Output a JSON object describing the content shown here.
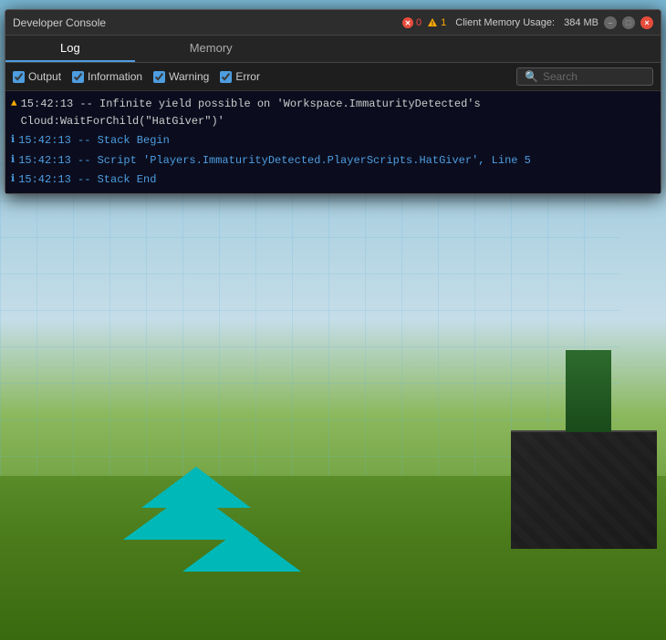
{
  "titleBar": {
    "title": "Developer Console",
    "errorCount": "0",
    "warningCount": "1",
    "memoryLabel": "Client Memory Usage:",
    "memoryValue": "384 MB",
    "minimizeLabel": "–",
    "maximizeLabel": "□",
    "closeLabel": "×"
  },
  "tabs": [
    {
      "id": "log",
      "label": "Log",
      "active": true
    },
    {
      "id": "memory",
      "label": "Memory",
      "active": false
    }
  ],
  "filters": [
    {
      "id": "output",
      "label": "Output",
      "checked": true
    },
    {
      "id": "information",
      "label": "Information",
      "checked": true
    },
    {
      "id": "warning",
      "label": "Warning",
      "checked": true
    },
    {
      "id": "error",
      "label": "Error",
      "checked": true
    }
  ],
  "search": {
    "placeholder": "Search"
  },
  "logLines": [
    {
      "type": "warning",
      "icon": "▲",
      "text": "15:42:13 -- Infinite yield possible on 'Workspace.ImmaturityDetected's Cloud:WaitForChild(\"HatGiver\")'",
      "color": "warning"
    },
    {
      "type": "info",
      "icon": "ℹ",
      "text": "15:42:13 -- Stack Begin",
      "color": "info"
    },
    {
      "type": "info",
      "icon": "ℹ",
      "text": "15:42:13 -- Script 'Players.ImmaturityDetected.PlayerScripts.HatGiver', Line 5",
      "color": "info"
    },
    {
      "type": "info",
      "icon": "ℹ",
      "text": "15:42:13 -- Stack End",
      "color": "info"
    }
  ]
}
